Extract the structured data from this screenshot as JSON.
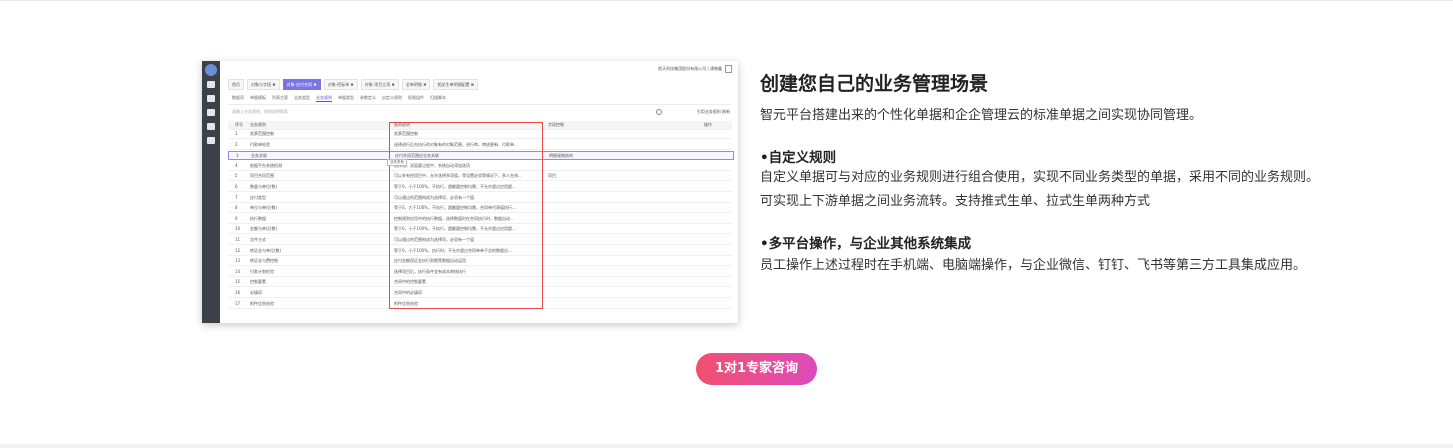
{
  "screenshot": {
    "header_right": "航天科技集团股份有限公司 | 谭晓鑫",
    "tabs": [
      {
        "label": "首页",
        "active": false
      },
      {
        "label": "对象与字段 ✖",
        "active": false
      },
      {
        "label": "对象-应付合同 ✖",
        "active": true
      },
      {
        "label": "对象-招标单 ✖",
        "active": false
      },
      {
        "label": "对象-项目立项 ✖",
        "active": false
      },
      {
        "label": "全单明细 ✖",
        "active": false
      },
      {
        "label": "相关生单明细配置 ✖",
        "active": false
      }
    ],
    "subtabs": [
      {
        "label": "数据项",
        "active": false
      },
      {
        "label": "单据模板",
        "active": false
      },
      {
        "label": "列表方案",
        "active": false
      },
      {
        "label": "业务类型",
        "active": false
      },
      {
        "label": "业务规则",
        "active": true
      },
      {
        "label": "单据类型",
        "active": false
      },
      {
        "label": "参数定义",
        "active": false
      },
      {
        "label": "自定义规则",
        "active": false
      },
      {
        "label": "权限组件",
        "active": false
      },
      {
        "label": "扫描脚本",
        "active": false
      }
    ],
    "search_placeholder": "请输入业务规则、规则说明搜索",
    "toolbar_right": "引用业务规则   刷新",
    "tooltip": "业务关系",
    "table_headers": {
      "no": "序号",
      "name": "业务规则",
      "desc": "规则说明",
      "field": "字段控制",
      "op": "操作"
    },
    "rows": [
      {
        "no": "1",
        "name": "发票范围控制",
        "desc": "发票范围控制",
        "field": "",
        "highlight": false
      },
      {
        "no": "2",
        "name": "付款单检验",
        "desc": "选择进行后台执行的对象有的对象范围，进行审，审核更新，付款单...",
        "field": "",
        "highlight": false
      },
      {
        "no": "3",
        "name": "业务关联",
        "desc": "应付合同范围应业务关联",
        "field": "明细规格结构",
        "highlight": true
      },
      {
        "no": "4",
        "name": "依据平台系统检测",
        "desc": "选择框，双面要过程中，系统自动添加选项",
        "field": "",
        "highlight": false
      },
      {
        "no": "5",
        "name": "项目合同范围",
        "desc": "可以多有控项目中，允许选择多项值，等设置必须等情况下，多人在线...",
        "field": "项目",
        "highlight": false
      },
      {
        "no": "6",
        "name": "数量与单位(数)",
        "desc": "等于0，小于100%，不执行，超额量控制均需，不允许超过应用超...",
        "field": "",
        "highlight": false
      },
      {
        "no": "7",
        "name": "应付类型",
        "desc": "可以通过的范围构成为选择项，必须有一个值",
        "field": "",
        "highlight": false
      },
      {
        "no": "8",
        "name": "单位与单位(数)",
        "desc": "等于0，大于100%，不执行，超额量控制均需，合同单代表值执行...",
        "field": "",
        "highlight": false
      },
      {
        "no": "9",
        "name": "执行数据",
        "desc": "控制规则应用中的执行数据，选择数值时在合同执行时，数据自动...",
        "field": "",
        "highlight": false
      },
      {
        "no": "10",
        "name": "金额与单位(数)",
        "desc": "等于0，小于100%，不执行，超额量控制均需，不允许超过应用超...",
        "field": "",
        "highlight": false
      },
      {
        "no": "11",
        "name": "文件方式",
        "desc": "可以通过的范围构成为选择项，必须有一个值",
        "field": "",
        "highlight": false
      },
      {
        "no": "12",
        "name": "转证金与单位(数)",
        "desc": "等于0，小于100%，执行时，不允许超过合同单单子总的数据出...",
        "field": "",
        "highlight": false
      },
      {
        "no": "13",
        "name": "转证金与费控制",
        "desc": "应付金额保证金执行到期等数据自动运用",
        "field": "",
        "highlight": false
      },
      {
        "no": "14",
        "name": "付款计划检验",
        "desc": "选择项目后，执行条件会有成本审核执行",
        "field": "",
        "highlight": false
      },
      {
        "no": "15",
        "name": "控制要素",
        "desc": "合同中的控制要素",
        "field": "",
        "highlight": false
      },
      {
        "no": "16",
        "name": "必填项",
        "desc": "合同中的必填项",
        "field": "",
        "highlight": false
      },
      {
        "no": "17",
        "name": "附件信息校验",
        "desc": "附件信息校验",
        "field": "",
        "highlight": false
      }
    ]
  },
  "content": {
    "title": "创建您自己的业务管理场景",
    "intro": "智元平台搭建出来的个性化单据和企企管理云的标准单据之间实现协同管理。",
    "features": [
      {
        "title": "•自定义规则",
        "text": "自定义单据可与对应的业务规则进行组合使用，实现不同业务类型的单据，采用不同的业务规则。可实现上下游单据之间业务流转。支持推式生单、拉式生单两种方式"
      },
      {
        "title": "•多平台操作，与企业其他系统集成",
        "text": "员工操作上述过程时在手机端、电脑端操作，与企业微信、钉钉、飞书等第三方工具集成应用。"
      }
    ]
  },
  "cta_label": "1对1专家咨询",
  "colors": {
    "accent": "#7a74e6",
    "cta_start": "#f2506e",
    "cta_end": "#dc4bbb",
    "highlight_box": "#e84b4b"
  }
}
